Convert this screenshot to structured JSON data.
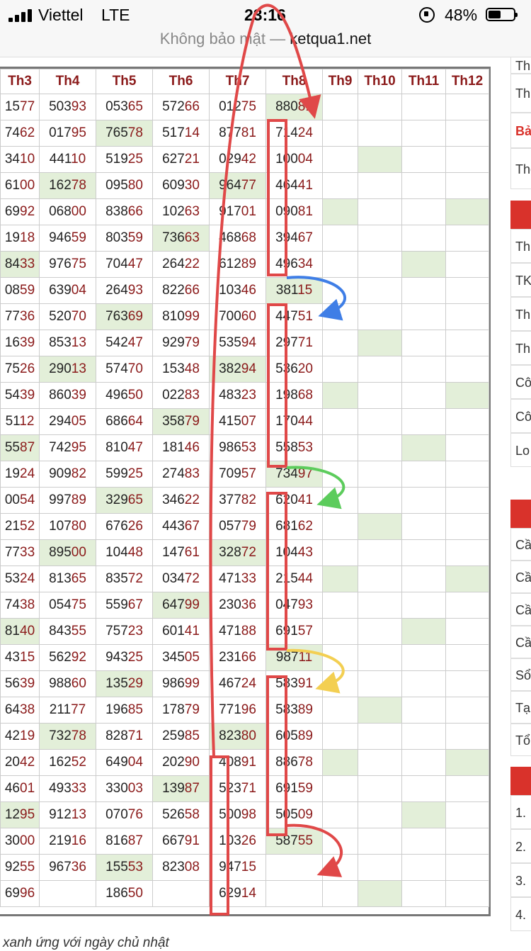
{
  "status_bar": {
    "carrier": "Viettel",
    "network": "LTE",
    "time": "23:16",
    "battery_percent": "48%"
  },
  "url_bar": {
    "prefix": "Không bảo mật —",
    "host": "ketqua1.net"
  },
  "table": {
    "headers": [
      "Th3",
      "Th4",
      "Th5",
      "Th6",
      "Th7",
      "Th8",
      "Th9",
      "Th10",
      "Th11",
      "Th12"
    ],
    "rows": [
      [
        "1577",
        "50393",
        "05365",
        "57266",
        "01275",
        "88081",
        "",
        "",
        "",
        ""
      ],
      [
        "7462",
        "01795",
        "76578",
        "51714",
        "87781",
        "71424",
        "",
        "",
        "",
        ""
      ],
      [
        "3410",
        "44110",
        "51925",
        "62721",
        "02942",
        "10004",
        "",
        "",
        "",
        ""
      ],
      [
        "6100",
        "16278",
        "09580",
        "60930",
        "96477",
        "46441",
        "",
        "",
        "",
        ""
      ],
      [
        "6992",
        "06800",
        "83866",
        "10263",
        "91701",
        "09081",
        "",
        "",
        "",
        ""
      ],
      [
        "1918",
        "94659",
        "80359",
        "73663",
        "46868",
        "39467",
        "",
        "",
        "",
        ""
      ],
      [
        "8433",
        "97675",
        "70447",
        "26422",
        "61289",
        "49634",
        "",
        "",
        "",
        ""
      ],
      [
        "0859",
        "63904",
        "26493",
        "82266",
        "10346",
        "38115",
        "",
        "",
        "",
        ""
      ],
      [
        "7736",
        "52070",
        "76369",
        "81099",
        "70060",
        "44751",
        "",
        "",
        "",
        ""
      ],
      [
        "1639",
        "85313",
        "54247",
        "92979",
        "53594",
        "29771",
        "",
        "",
        "",
        ""
      ],
      [
        "7526",
        "29013",
        "57470",
        "15348",
        "38294",
        "53620",
        "",
        "",
        "",
        ""
      ],
      [
        "5439",
        "86039",
        "49650",
        "02283",
        "48323",
        "19868",
        "",
        "",
        "",
        ""
      ],
      [
        "5112",
        "29405",
        "68664",
        "35879",
        "41507",
        "17044",
        "",
        "",
        "",
        ""
      ],
      [
        "5587",
        "74295",
        "81047",
        "18146",
        "98653",
        "55853",
        "",
        "",
        "",
        ""
      ],
      [
        "1924",
        "90982",
        "59925",
        "27483",
        "70957",
        "73497",
        "",
        "",
        "",
        ""
      ],
      [
        "0054",
        "99789",
        "32965",
        "34622",
        "37782",
        "62041",
        "",
        "",
        "",
        ""
      ],
      [
        "2152",
        "10780",
        "67626",
        "44367",
        "05779",
        "68162",
        "",
        "",
        "",
        ""
      ],
      [
        "7733",
        "89500",
        "10448",
        "14761",
        "32872",
        "10443",
        "",
        "",
        "",
        ""
      ],
      [
        "5324",
        "81365",
        "83572",
        "03472",
        "47133",
        "21544",
        "",
        "",
        "",
        ""
      ],
      [
        "7438",
        "05475",
        "55967",
        "64799",
        "23036",
        "04793",
        "",
        "",
        "",
        ""
      ],
      [
        "8140",
        "84355",
        "75723",
        "60141",
        "47188",
        "69157",
        "",
        "",
        "",
        ""
      ],
      [
        "4315",
        "56292",
        "94325",
        "34505",
        "23166",
        "98711",
        "",
        "",
        "",
        ""
      ],
      [
        "5639",
        "98860",
        "13529",
        "98699",
        "46724",
        "58391",
        "",
        "",
        "",
        ""
      ],
      [
        "6438",
        "21177",
        "19685",
        "17879",
        "77196",
        "58389",
        "",
        "",
        "",
        ""
      ],
      [
        "4219",
        "73278",
        "82871",
        "25985",
        "82380",
        "60589",
        "",
        "",
        "",
        ""
      ],
      [
        "2042",
        "16252",
        "64904",
        "20290",
        "40891",
        "88678",
        "",
        "",
        "",
        ""
      ],
      [
        "4601",
        "49333",
        "33003",
        "13987",
        "52371",
        "69159",
        "",
        "",
        "",
        ""
      ],
      [
        "1295",
        "91213",
        "07076",
        "52658",
        "50098",
        "50509",
        "",
        "",
        "",
        ""
      ],
      [
        "3000",
        "21916",
        "81687",
        "66791",
        "10326",
        "58755",
        "",
        "",
        "",
        ""
      ],
      [
        "9255",
        "96736",
        "15553",
        "82308",
        "94715",
        "",
        "",
        "",
        "",
        ""
      ],
      [
        "6996",
        "",
        "18650",
        "",
        "62914",
        "",
        "",
        "",
        "",
        ""
      ]
    ],
    "highlighted_cells": [
      [
        0,
        5
      ],
      [
        1,
        2
      ],
      [
        2,
        7
      ],
      [
        3,
        1
      ],
      [
        3,
        4
      ],
      [
        4,
        6
      ],
      [
        4,
        9
      ],
      [
        5,
        3
      ],
      [
        6,
        0
      ],
      [
        6,
        8
      ],
      [
        7,
        5
      ],
      [
        8,
        2
      ],
      [
        9,
        7
      ],
      [
        10,
        1
      ],
      [
        10,
        4
      ],
      [
        11,
        6
      ],
      [
        11,
        9
      ],
      [
        12,
        3
      ],
      [
        13,
        0
      ],
      [
        13,
        8
      ],
      [
        14,
        5
      ],
      [
        15,
        2
      ],
      [
        16,
        7
      ],
      [
        17,
        1
      ],
      [
        17,
        4
      ],
      [
        18,
        6
      ],
      [
        18,
        9
      ],
      [
        19,
        3
      ],
      [
        20,
        0
      ],
      [
        20,
        8
      ],
      [
        21,
        5
      ],
      [
        22,
        2
      ],
      [
        23,
        7
      ],
      [
        24,
        1
      ],
      [
        24,
        4
      ],
      [
        25,
        6
      ],
      [
        25,
        9
      ],
      [
        26,
        3
      ],
      [
        27,
        0
      ],
      [
        27,
        8
      ],
      [
        28,
        5
      ],
      [
        29,
        2
      ],
      [
        30,
        7
      ]
    ]
  },
  "sidebar": {
    "items_group1": [
      "Th",
      "Th",
      "Bả",
      "The the"
    ],
    "items_group2": [
      "Th",
      "TK",
      "Th",
      "Th",
      "Cô",
      "Cô VIP",
      "Lo"
    ],
    "items_group3": [
      "Cầ",
      "Cầ",
      "Cầ",
      "Cầ",
      "Sổ",
      "Tạ",
      "Tổ"
    ],
    "items_group4": [
      "1.",
      "2.",
      "3.",
      "4."
    ]
  },
  "footer_note": "xanh ứng với ngày chủ nhật"
}
